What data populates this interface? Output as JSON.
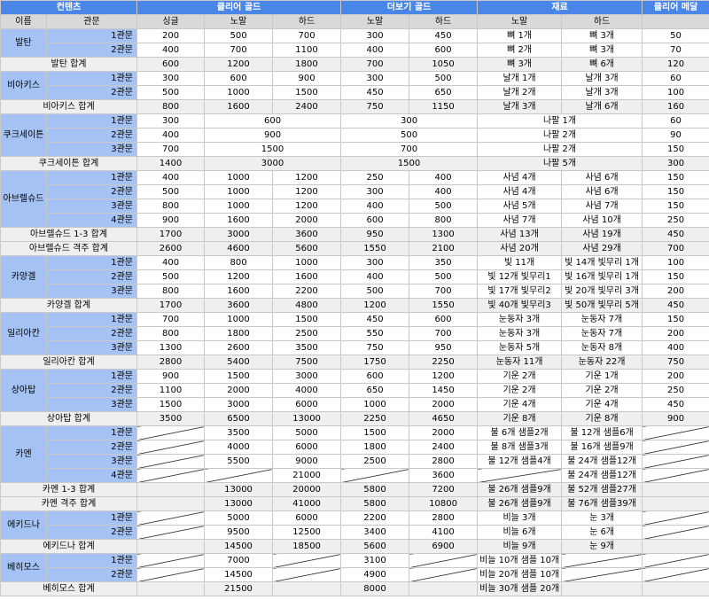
{
  "headers": {
    "content": "컨텐츠",
    "clear_gold": "클리어 골드",
    "more_gold": "더보기 골드",
    "materials": "재료",
    "clear_medal": "클리어 메달",
    "name": "이름",
    "stage": "관문",
    "single": "싱글",
    "normal": "노말",
    "hard": "하드",
    "more_normal": "노말",
    "more_hard": "하드",
    "mat_normal": "노말",
    "mat_hard": "하드"
  },
  "rows": [
    {
      "type": "stage",
      "name": "발탄",
      "rowspan": 2,
      "stage": "1관문",
      "single": "200",
      "normal": "500",
      "hard": "700",
      "mn": "300",
      "mh": "450",
      "matn": "뼈 1개",
      "math": "뼈 3개",
      "medal": "50"
    },
    {
      "type": "stage",
      "stage": "2관문",
      "single": "400",
      "normal": "700",
      "hard": "1100",
      "mn": "400",
      "mh": "600",
      "matn": "뼈 2개",
      "math": "뼈 3개",
      "medal": "70"
    },
    {
      "type": "total",
      "label": "발탄 합계",
      "single": "600",
      "normal": "1200",
      "hard": "1800",
      "mn": "700",
      "mh": "1050",
      "matn": "뼈 3개",
      "math": "뼈 6개",
      "medal": "120"
    },
    {
      "type": "stage",
      "name": "비아키스",
      "rowspan": 2,
      "stage": "1관문",
      "single": "300",
      "normal": "600",
      "hard": "900",
      "mn": "300",
      "mh": "500",
      "matn": "날개 1개",
      "math": "날개 3개",
      "medal": "60"
    },
    {
      "type": "stage",
      "stage": "2관문",
      "single": "500",
      "normal": "1000",
      "hard": "1500",
      "mn": "450",
      "mh": "650",
      "matn": "날개 2개",
      "math": "날개 3개",
      "medal": "100"
    },
    {
      "type": "total",
      "label": "비아키스 합계",
      "single": "800",
      "normal": "1600",
      "hard": "2400",
      "mn": "750",
      "mh": "1150",
      "matn": "날개 3개",
      "math": "날개 6개",
      "medal": "160"
    },
    {
      "type": "merged",
      "name": "쿠크세이튼",
      "rowspan": 3,
      "stage": "1관문",
      "single": "300",
      "gold": "600",
      "more": "300",
      "mat": "나팔 1개",
      "medal": "60"
    },
    {
      "type": "merged",
      "stage": "2관문",
      "single": "400",
      "gold": "900",
      "more": "500",
      "mat": "나팔 2개",
      "medal": "90"
    },
    {
      "type": "merged",
      "stage": "3관문",
      "single": "700",
      "gold": "1500",
      "more": "700",
      "mat": "나팔 2개",
      "medal": "150"
    },
    {
      "type": "mergedtotal",
      "label": "쿠크세이튼 합계",
      "single": "1400",
      "gold": "3000",
      "more": "1500",
      "mat": "나팔 5개",
      "medal": "300"
    },
    {
      "type": "stage",
      "name": "아브렐슈드",
      "rowspan": 4,
      "stage": "1관문",
      "single": "400",
      "normal": "1000",
      "hard": "1200",
      "mn": "250",
      "mh": "400",
      "matn": "사념 4개",
      "math": "사념 6개",
      "medal": "150"
    },
    {
      "type": "stage",
      "stage": "2관문",
      "single": "500",
      "normal": "1000",
      "hard": "1200",
      "mn": "300",
      "mh": "400",
      "matn": "사념 4개",
      "math": "사념 6개",
      "medal": "150"
    },
    {
      "type": "stage",
      "stage": "3관문",
      "single": "800",
      "normal": "1000",
      "hard": "1200",
      "mn": "400",
      "mh": "500",
      "matn": "사념 5개",
      "math": "사념 7개",
      "medal": "150"
    },
    {
      "type": "stage",
      "stage": "4관문",
      "single": "900",
      "normal": "1600",
      "hard": "2000",
      "mn": "600",
      "mh": "800",
      "matn": "사념 7개",
      "math": "사념 10개",
      "medal": "250"
    },
    {
      "type": "total",
      "label": "아브렐슈드 1-3 합계",
      "single": "1700",
      "normal": "3000",
      "hard": "3600",
      "mn": "950",
      "mh": "1300",
      "matn": "사념 13개",
      "math": "사념 19개",
      "medal": "450"
    },
    {
      "type": "total",
      "label": "아브렐슈드 격주 합계",
      "single": "2600",
      "normal": "4600",
      "hard": "5600",
      "mn": "1550",
      "mh": "2100",
      "matn": "사념 20개",
      "math": "사념 29개",
      "medal": "700"
    },
    {
      "type": "stage",
      "name": "카양겔",
      "rowspan": 3,
      "stage": "1관문",
      "single": "400",
      "normal": "800",
      "hard": "1000",
      "mn": "300",
      "mh": "350",
      "matn": "빛 11개",
      "math": "빛 14개 빛무리 1개",
      "medal": "100"
    },
    {
      "type": "stage",
      "stage": "2관문",
      "single": "500",
      "normal": "1200",
      "hard": "1600",
      "mn": "400",
      "mh": "500",
      "matn": "빛 12개 빛무리1",
      "math": "빛 16개 빛무리 1개",
      "medal": "150"
    },
    {
      "type": "stage",
      "stage": "3관문",
      "single": "800",
      "normal": "1600",
      "hard": "2200",
      "mn": "500",
      "mh": "700",
      "matn": "빛 17개 빛무리2",
      "math": "빛 20개 빛무리 3개",
      "medal": "200"
    },
    {
      "type": "total",
      "label": "카양겔 합계",
      "single": "1700",
      "normal": "3600",
      "hard": "4800",
      "mn": "1200",
      "mh": "1550",
      "matn": "빛 40개 빛무리3",
      "math": "빛 50개 빛무리 5개",
      "medal": "450"
    },
    {
      "type": "stage",
      "name": "일리아칸",
      "rowspan": 3,
      "stage": "1관문",
      "single": "700",
      "normal": "1000",
      "hard": "1500",
      "mn": "450",
      "mh": "600",
      "matn": "눈동자 3개",
      "math": "눈동자 7개",
      "medal": "150"
    },
    {
      "type": "stage",
      "stage": "2관문",
      "single": "800",
      "normal": "1800",
      "hard": "2500",
      "mn": "550",
      "mh": "700",
      "matn": "눈동자 3개",
      "math": "눈동자 7개",
      "medal": "200"
    },
    {
      "type": "stage",
      "stage": "3관문",
      "single": "1300",
      "normal": "2600",
      "hard": "3500",
      "mn": "750",
      "mh": "950",
      "matn": "눈동자 5개",
      "math": "눈동자 8개",
      "medal": "400"
    },
    {
      "type": "total",
      "label": "일리아칸 합계",
      "single": "2800",
      "normal": "5400",
      "hard": "7500",
      "mn": "1750",
      "mh": "2250",
      "matn": "눈동자 11개",
      "math": "눈동자 22개",
      "medal": "750"
    },
    {
      "type": "stage",
      "name": "상아탑",
      "rowspan": 3,
      "stage": "1관문",
      "single": "900",
      "normal": "1500",
      "hard": "3000",
      "mn": "600",
      "mh": "1200",
      "matn": "기운 2개",
      "math": "기운 1개",
      "medal": "200"
    },
    {
      "type": "stage",
      "stage": "2관문",
      "single": "1100",
      "normal": "2000",
      "hard": "4000",
      "mn": "650",
      "mh": "1450",
      "matn": "기운 2개",
      "math": "기운 2개",
      "medal": "250"
    },
    {
      "type": "stage",
      "stage": "3관문",
      "single": "1500",
      "normal": "3000",
      "hard": "6000",
      "mn": "1000",
      "mh": "2000",
      "matn": "기운 4개",
      "math": "기운 4개",
      "medal": "450"
    },
    {
      "type": "total",
      "label": "상아탑 합계",
      "single": "3500",
      "normal": "6500",
      "hard": "13000",
      "mn": "2250",
      "mh": "4650",
      "matn": "기운 8개",
      "math": "기운 8개",
      "medal": "900"
    },
    {
      "type": "stage",
      "name": "카멘",
      "rowspan": 4,
      "stage": "1관문",
      "single": "",
      "normal": "3500",
      "hard": "5000",
      "mn": "1500",
      "mh": "2000",
      "matn": "불 6개 샘플2개",
      "math": "불 12개 샘플6개",
      "medal": ""
    },
    {
      "type": "stage",
      "stage": "2관문",
      "single": "",
      "normal": "4000",
      "hard": "6000",
      "mn": "1800",
      "mh": "2400",
      "matn": "불 8개 샘플3개",
      "math": "불 16개 샘플9개",
      "medal": ""
    },
    {
      "type": "stage",
      "stage": "3관문",
      "single": "",
      "normal": "5500",
      "hard": "9000",
      "mn": "2500",
      "mh": "2800",
      "matn": "불 12개 샘플4개",
      "math": "불 24개 샘플12개",
      "medal": ""
    },
    {
      "type": "stage",
      "stage": "4관문",
      "single": "",
      "normal": "",
      "hard": "21000",
      "mn": "",
      "mh": "3600",
      "matn": "",
      "math": "불 24개 샘플12개",
      "medal": ""
    },
    {
      "type": "total",
      "label": "카멘 1-3 합계",
      "single": "",
      "normal": "13000",
      "hard": "20000",
      "mn": "5800",
      "mh": "7200",
      "matn": "불 26개 샘플9개",
      "math": "불 52개 샘플27개",
      "medal": ""
    },
    {
      "type": "total",
      "label": "카멘 격주 합계",
      "single": "",
      "normal": "13000",
      "hard": "41000",
      "mn": "5800",
      "mh": "10800",
      "matn": "불 26개 샘플9개",
      "math": "불 76개 샘플39개",
      "medal": ""
    },
    {
      "type": "stage",
      "name": "에키드나",
      "rowspan": 2,
      "stage": "1관문",
      "single": "",
      "normal": "5000",
      "hard": "6000",
      "mn": "2200",
      "mh": "2800",
      "matn": "비늘 3개",
      "math": "눈 3개",
      "medal": ""
    },
    {
      "type": "stage",
      "stage": "2관문",
      "single": "",
      "normal": "9500",
      "hard": "12500",
      "mn": "3400",
      "mh": "4100",
      "matn": "비늘 6개",
      "math": "눈 6개",
      "medal": ""
    },
    {
      "type": "total",
      "label": "에키드나 합계",
      "single": "",
      "normal": "14500",
      "hard": "18500",
      "mn": "5600",
      "mh": "6900",
      "matn": "비늘 9개",
      "math": "눈 9개",
      "medal": ""
    },
    {
      "type": "stage",
      "name": "베히모스",
      "rowspan": 2,
      "stage": "1관문",
      "single": "",
      "normal": "7000",
      "hard": "",
      "mn": "3100",
      "mh": "",
      "matn": "비늘 10개 샘플 10개",
      "math": "",
      "medal": ""
    },
    {
      "type": "stage",
      "stage": "2관문",
      "single": "",
      "normal": "14500",
      "hard": "",
      "mn": "4900",
      "mh": "",
      "matn": "비늘 20개 샘플 10개",
      "math": "",
      "medal": ""
    },
    {
      "type": "total",
      "label": "베히모스 합계",
      "single": "",
      "normal": "21500",
      "hard": "",
      "mn": "8000",
      "mh": "",
      "matn": "비늘 30개 샘플 20개",
      "math": "",
      "medal": ""
    }
  ]
}
